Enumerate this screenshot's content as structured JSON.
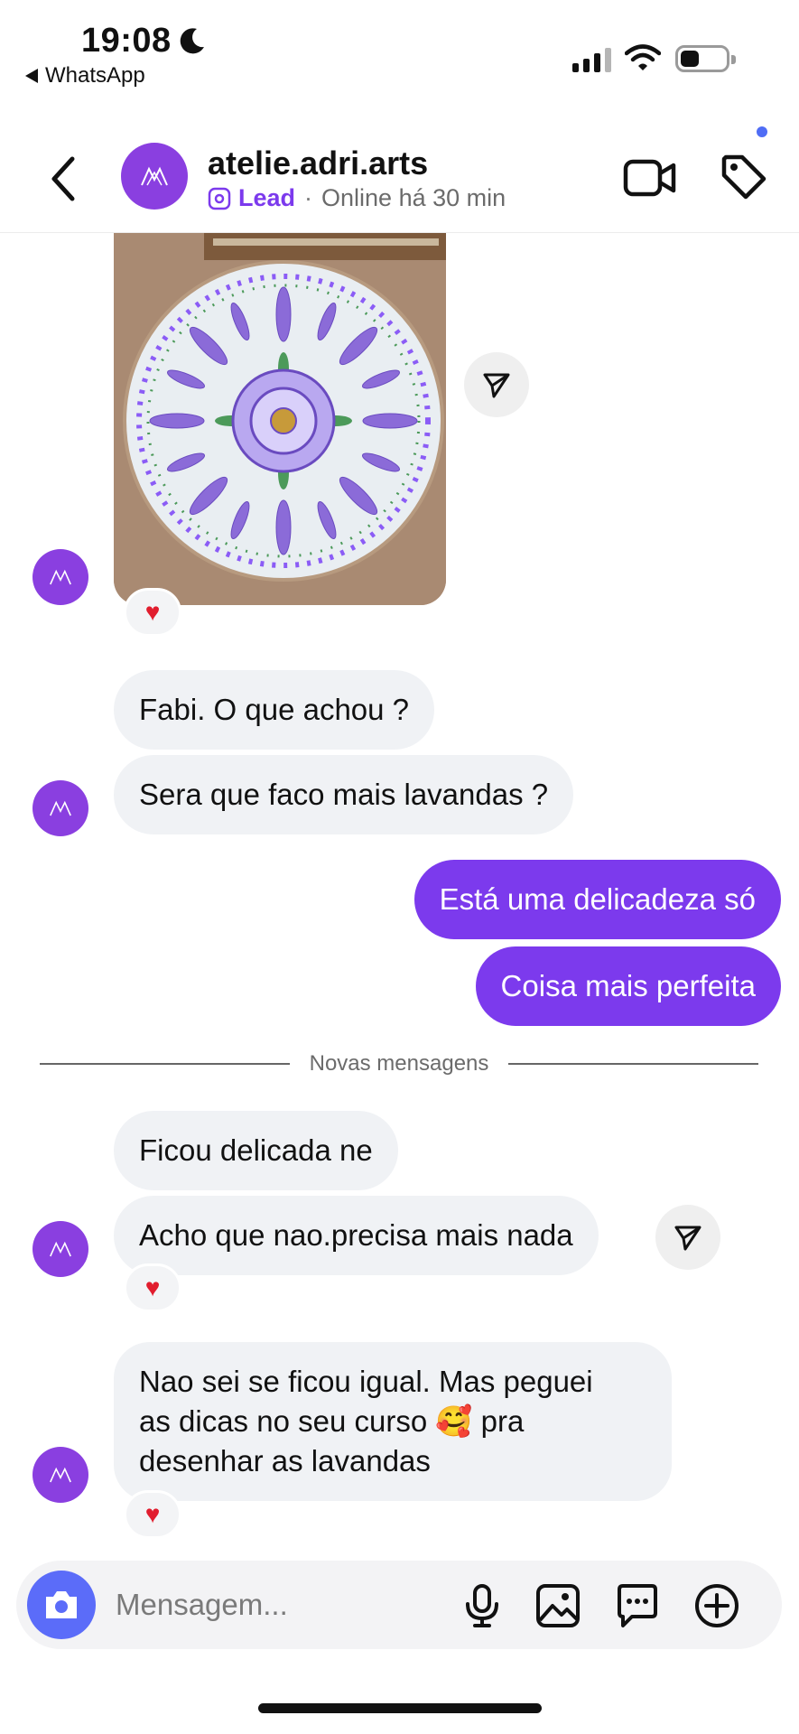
{
  "status_bar": {
    "time": "19:08",
    "back_app": "WhatsApp",
    "icons": [
      "moon-icon",
      "signal-icon",
      "wifi-icon",
      "battery-icon"
    ]
  },
  "header": {
    "title": "atelie.adri.arts",
    "label": "Lead",
    "separator": "·",
    "status": "Online há 30 min",
    "icons": [
      "back-chevron-icon",
      "video-call-icon",
      "tag-icon"
    ]
  },
  "messages": {
    "m1": "Fabi. O que achou ?",
    "m2": "Sera que faco mais lavandas ?",
    "m3": "Está uma delicadeza só",
    "m4": "Coisa mais perfeita",
    "m5": "Ficou delicada ne",
    "m6": "Acho que nao.precisa mais nada",
    "m7_line1": "Nao sei se ficou igual. Mas peguei",
    "m7_line2a": "as dicas no seu curso",
    "m7_emoji": "🥰",
    "m7_line2b": "pra",
    "m7_line3": "desenhar as lavandas"
  },
  "reactions": {
    "heart": "♥"
  },
  "divider": {
    "label": "Novas mensagens"
  },
  "composer": {
    "placeholder": "Mensagem...",
    "icons": [
      "camera-icon",
      "microphone-icon",
      "gallery-icon",
      "sticker-icon",
      "plus-icon"
    ]
  },
  "colors": {
    "accent": "#7c3aed",
    "camera_button": "#5b6cf9",
    "incoming_bubble": "#f0f2f5",
    "heart": "#e11d2e"
  }
}
